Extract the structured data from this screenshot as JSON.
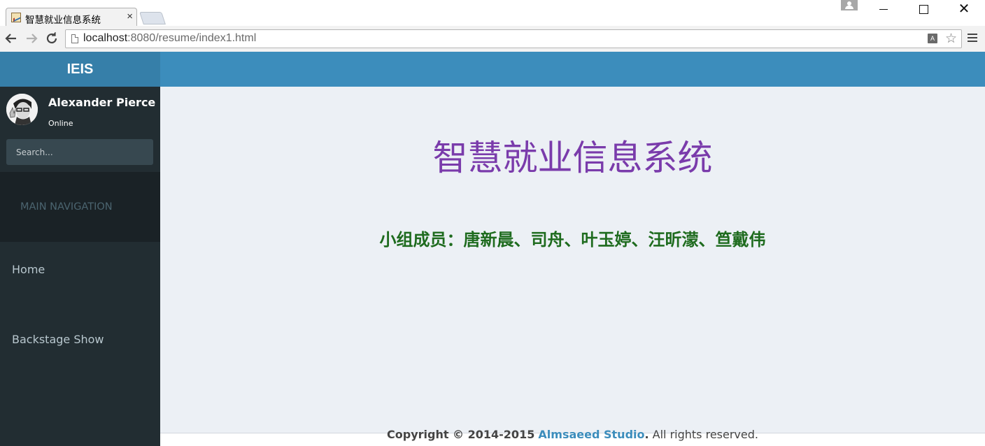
{
  "browser": {
    "tab_title": "智慧就业信息系统",
    "tab_close": "×",
    "url_host": "localhost",
    "url_rest": ":8080/resume/index1.html",
    "translate_glyph": "A"
  },
  "window_controls": {
    "close_glyph": "✕"
  },
  "app": {
    "logo": "IEIS",
    "user": {
      "name": "Alexander Pierce",
      "status": "Online"
    },
    "search": {
      "placeholder": "Search..."
    },
    "nav_header": "MAIN NAVIGATION",
    "menu": [
      {
        "label": "Home"
      },
      {
        "label": "Backstage Show"
      }
    ]
  },
  "content": {
    "title": "智慧就业信息系统",
    "members": "小组成员：唐新晨、司舟、叶玉婷、汪昕濛、笪戴伟"
  },
  "footer": {
    "copyright": "Copyright © 2014-2015",
    "link": "Almsaeed Studio",
    "rest": ". All rights reserved."
  },
  "colors": {
    "header": "#3c8dbc",
    "logo_bg": "#367fa9",
    "sidebar": "#222d32",
    "content_bg": "#ecf0f5",
    "title": "#7a3bab",
    "members": "#1e6b1e"
  }
}
